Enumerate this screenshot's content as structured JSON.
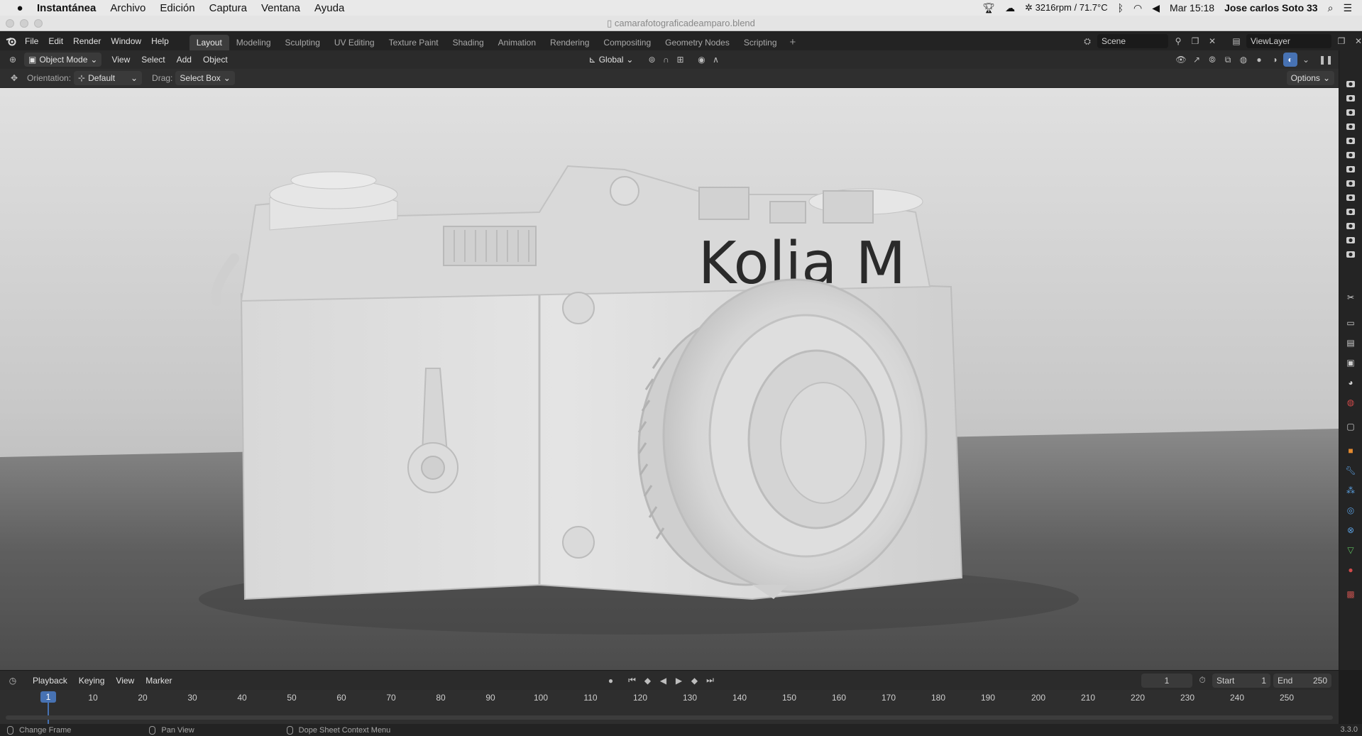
{
  "macbar": {
    "app": "Instantánea",
    "menus": [
      "Archivo",
      "Edición",
      "Captura",
      "Ventana",
      "Ayuda"
    ],
    "fan": "3216rpm / 71.7°C",
    "clock": "Mar 15:18",
    "user": "Jose carlos Soto 33"
  },
  "window": {
    "title": "camarafotograficadeamparo.blend"
  },
  "topbar": {
    "menus": [
      "File",
      "Edit",
      "Render",
      "Window",
      "Help"
    ],
    "workspaces": [
      "Layout",
      "Modeling",
      "Sculpting",
      "UV Editing",
      "Texture Paint",
      "Shading",
      "Animation",
      "Rendering",
      "Compositing",
      "Geometry Nodes",
      "Scripting"
    ],
    "active_workspace": "Layout",
    "scene": "Scene",
    "view_layer": "ViewLayer"
  },
  "header": {
    "mode": "Object Mode",
    "menus": [
      "View",
      "Select",
      "Add",
      "Object"
    ],
    "transform_orientation": "Global"
  },
  "toolsettings": {
    "orientation_label": "Orientation:",
    "orientation_value": "Default",
    "drag_label": "Drag:",
    "drag_value": "Select Box",
    "options_label": "Options"
  },
  "viewport": {
    "engraving": "Kolia M",
    "colors": {
      "background": "#cfcfcf",
      "floor": "#5a5a5a",
      "body": "#dcdcdc"
    }
  },
  "timeline": {
    "menus": [
      "Playback",
      "Keying",
      "View",
      "Marker"
    ],
    "current_frame": "1",
    "start_label": "Start",
    "start_value": "1",
    "end_label": "End",
    "end_value": "250",
    "ticks": [
      "10",
      "20",
      "30",
      "40",
      "50",
      "60",
      "70",
      "80",
      "90",
      "100",
      "110",
      "120",
      "130",
      "140",
      "150",
      "160",
      "170",
      "180",
      "190",
      "200",
      "210",
      "220",
      "230",
      "240",
      "250"
    ],
    "playhead_label": "1",
    "accent": "#4772b3"
  },
  "statusbar": {
    "items": [
      "Change Frame",
      "Pan View",
      "Dope Sheet Context Menu"
    ],
    "version": "3.3.0"
  }
}
